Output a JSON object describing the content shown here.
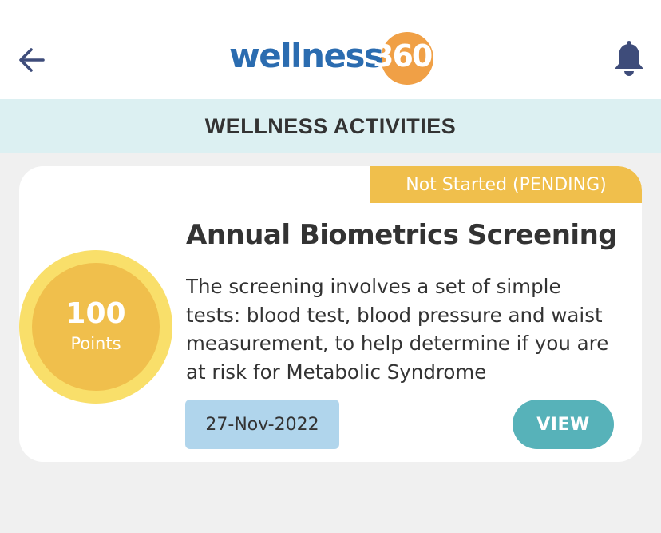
{
  "header": {
    "back_icon": "arrow-left-icon",
    "notification_icon": "bell-icon",
    "logo": {
      "word": "wellness",
      "number": "360"
    }
  },
  "section": {
    "title": "WELLNESS ACTIVITIES"
  },
  "activity": {
    "status": "Not Started (PENDING)",
    "points_value": "100",
    "points_label": "Points",
    "title": "Annual Biometrics Screening",
    "description": "The screening involves a set of simple tests: blood test, blood pressure and waist measurement, to help determine if you are at risk for Metabolic Syndrome",
    "date": "27-Nov-2022",
    "view_label": "VIEW"
  },
  "colors": {
    "brand_blue": "#2b6cb0",
    "brand_orange": "#f0a046",
    "section_bg": "#dcf0f2",
    "status_yellow": "#f0bf4c",
    "points_ring": "#f9df6a",
    "date_bg": "#b0d5ec",
    "view_button": "#57b2b9",
    "icon_navy": "#3e4c7a"
  }
}
